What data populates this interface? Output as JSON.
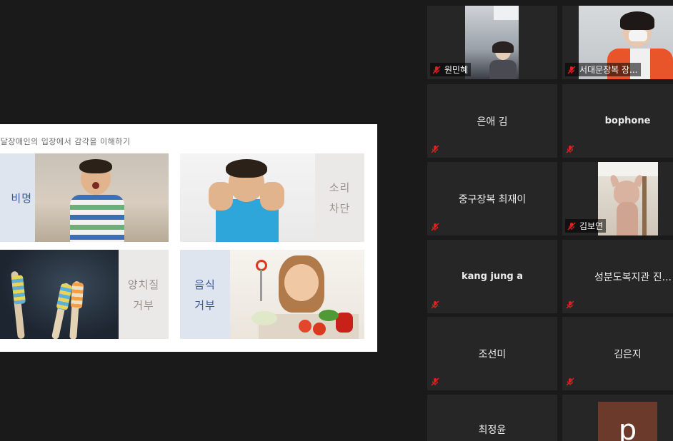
{
  "slide": {
    "title": "발달장애인의 입장에서 감각을 이해하기",
    "panels": [
      {
        "label_lines": [
          "비명",
          ""
        ]
      },
      {
        "label_lines": [
          "소리",
          "차단"
        ]
      },
      {
        "label_lines": [
          "양치질",
          "거부"
        ]
      },
      {
        "label_lines": [
          "음식",
          "거부"
        ]
      }
    ]
  },
  "participants": [
    {
      "name": "원민혜",
      "video": true
    },
    {
      "name": "서대문장복 장...",
      "video": true
    },
    {
      "name": "은애 김",
      "video": false
    },
    {
      "name": "bophone",
      "video": false
    },
    {
      "name": "중구장복 최재이",
      "video": false
    },
    {
      "name": "김보연",
      "video": true
    },
    {
      "name": "kang jung a",
      "video": false
    },
    {
      "name": "성분도복지관 진...",
      "video": false
    },
    {
      "name": "조선미",
      "video": false
    },
    {
      "name": "김은지",
      "video": false
    },
    {
      "name": "최정윤",
      "video": false
    },
    {
      "name": "p",
      "video": false
    }
  ],
  "colors": {
    "background": "#1a1a1a",
    "tile": "#262626",
    "mute_icon": "#e02020",
    "label_blue": "#3b5a96",
    "label_grey": "#9a918a"
  }
}
